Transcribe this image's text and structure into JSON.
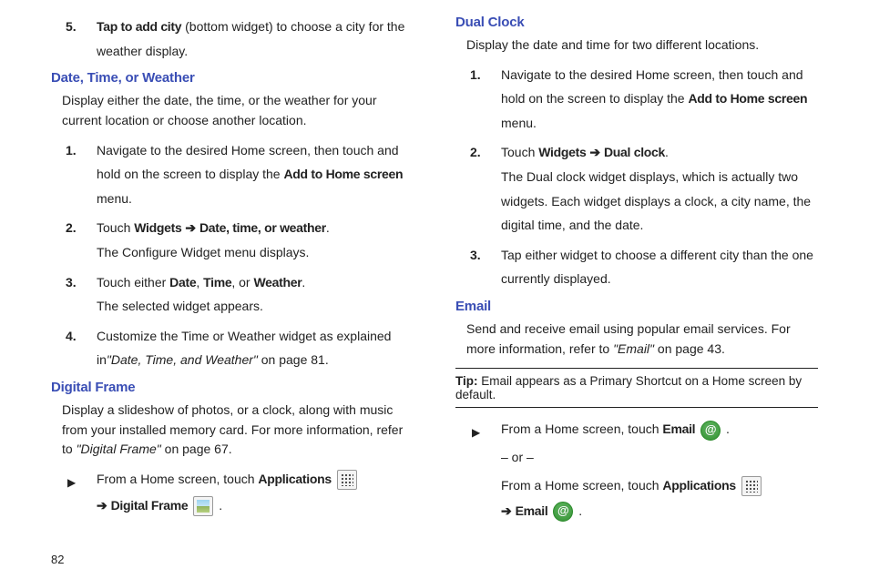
{
  "pagenum": "82",
  "left": {
    "step5": {
      "num": "5.",
      "lead": "Tap to add city",
      "rest": " (bottom widget) to choose a city for the weather display."
    },
    "secA": {
      "title": "Date, Time, or Weather",
      "intro": "Display either the date, the time, or the weather for your current location or choose another location.",
      "s1": {
        "num": "1.",
        "a": "Navigate to the desired Home screen, then touch and hold on the screen to display the ",
        "b": "Add to Home screen",
        "c": " menu."
      },
      "s2": {
        "num": "2.",
        "a": "Touch ",
        "b": "Widgets",
        "arr": " ➔ ",
        "c": "Date, time, or weather",
        "d": ".",
        "after": "The Configure Widget menu displays."
      },
      "s3": {
        "num": "3.",
        "a": "Touch either ",
        "b": "Date",
        "c": ", ",
        "d": "Time",
        "e": ", or ",
        "f": "Weather",
        "g": ".",
        "after": "The selected widget appears."
      },
      "s4": {
        "num": "4.",
        "a": "Customize the Time or Weather widget as explained in",
        "ref": "\"Date, Time, and Weather\"",
        "b": " on page 81."
      }
    },
    "secB": {
      "title": "Digital Frame",
      "intro_a": "Display a slideshow of photos, or a clock, along with music from your installed memory card. For more information, refer to ",
      "intro_ref": "\"Digital Frame\"",
      "intro_b": "  on page 67.",
      "bullet": {
        "a": "From a Home screen, touch ",
        "b": "Applications",
        "arr": "➔ ",
        "c": "Digital Frame",
        "d": " ."
      }
    }
  },
  "right": {
    "secC": {
      "title": "Dual Clock",
      "intro": "Display the date and time for two different locations.",
      "s1": {
        "num": "1.",
        "a": "Navigate to the desired Home screen, then touch and hold on the screen to display the ",
        "b": "Add to Home screen",
        "c": " menu."
      },
      "s2": {
        "num": "2.",
        "a": "Touch ",
        "b": "Widgets",
        "arr": " ➔ ",
        "c": "Dual clock",
        "d": ".",
        "after": "The Dual clock widget displays, which is actually two widgets.  Each widget displays a clock, a city name, the digital time, and the date."
      },
      "s3": {
        "num": "3.",
        "a": "Tap either widget to choose a different city than the one currently displayed."
      }
    },
    "secD": {
      "title": "Email",
      "intro_a": "Send and receive email using popular email services. For more information, refer to ",
      "intro_ref": "\"Email\"",
      "intro_b": "  on page 43.",
      "tip_label": "Tip:",
      "tip": " Email appears as a Primary Shortcut on a Home screen by default.",
      "bullet": {
        "a": "From a Home screen, touch ",
        "b": "Email",
        "c": " .",
        "or": "– or –",
        "d": "From a Home screen, touch ",
        "e": "Applications",
        "arr": "➔ ",
        "f": "Email",
        "g": " ."
      }
    }
  }
}
